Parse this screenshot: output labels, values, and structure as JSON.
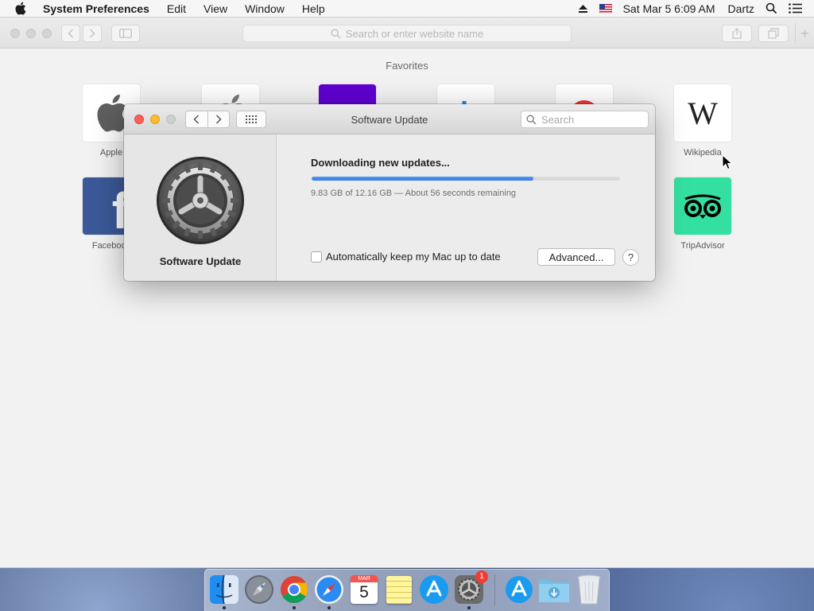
{
  "menubar": {
    "app_name": "System Preferences",
    "items": [
      "Edit",
      "View",
      "Window",
      "Help"
    ],
    "clock": "Sat Mar 5  6:09 AM",
    "user": "Dartz"
  },
  "safari": {
    "address_placeholder": "Search or enter website name",
    "favorites_heading": "Favorites",
    "favorites": [
      {
        "label": "Apple"
      },
      {
        "label": ""
      },
      {
        "label": ""
      },
      {
        "label": ""
      },
      {
        "label": ""
      },
      {
        "label": "Wikipedia"
      },
      {
        "label": "Facebook"
      },
      {
        "label": "TripAdvisor"
      }
    ]
  },
  "software_update": {
    "title": "Software Update",
    "search_placeholder": "Search",
    "pane_title": "Software Update",
    "status": "Downloading new updates...",
    "progress_fraction": 0.72,
    "detail": "9.83 GB of 12.16 GB — About 56 seconds remaining",
    "auto_update_label": "Automatically keep my Mac up to date",
    "advanced_label": "Advanced...",
    "help_label": "?"
  },
  "dock": {
    "calendar_month": "MAR",
    "calendar_day": "5",
    "sysprefs_badge": "1"
  },
  "colors": {
    "progress": "#2c78e6",
    "close": "#fc5f57",
    "minimize": "#fdbc2e",
    "tripadvisor": "#34e0a1",
    "facebook": "#3b5998"
  }
}
